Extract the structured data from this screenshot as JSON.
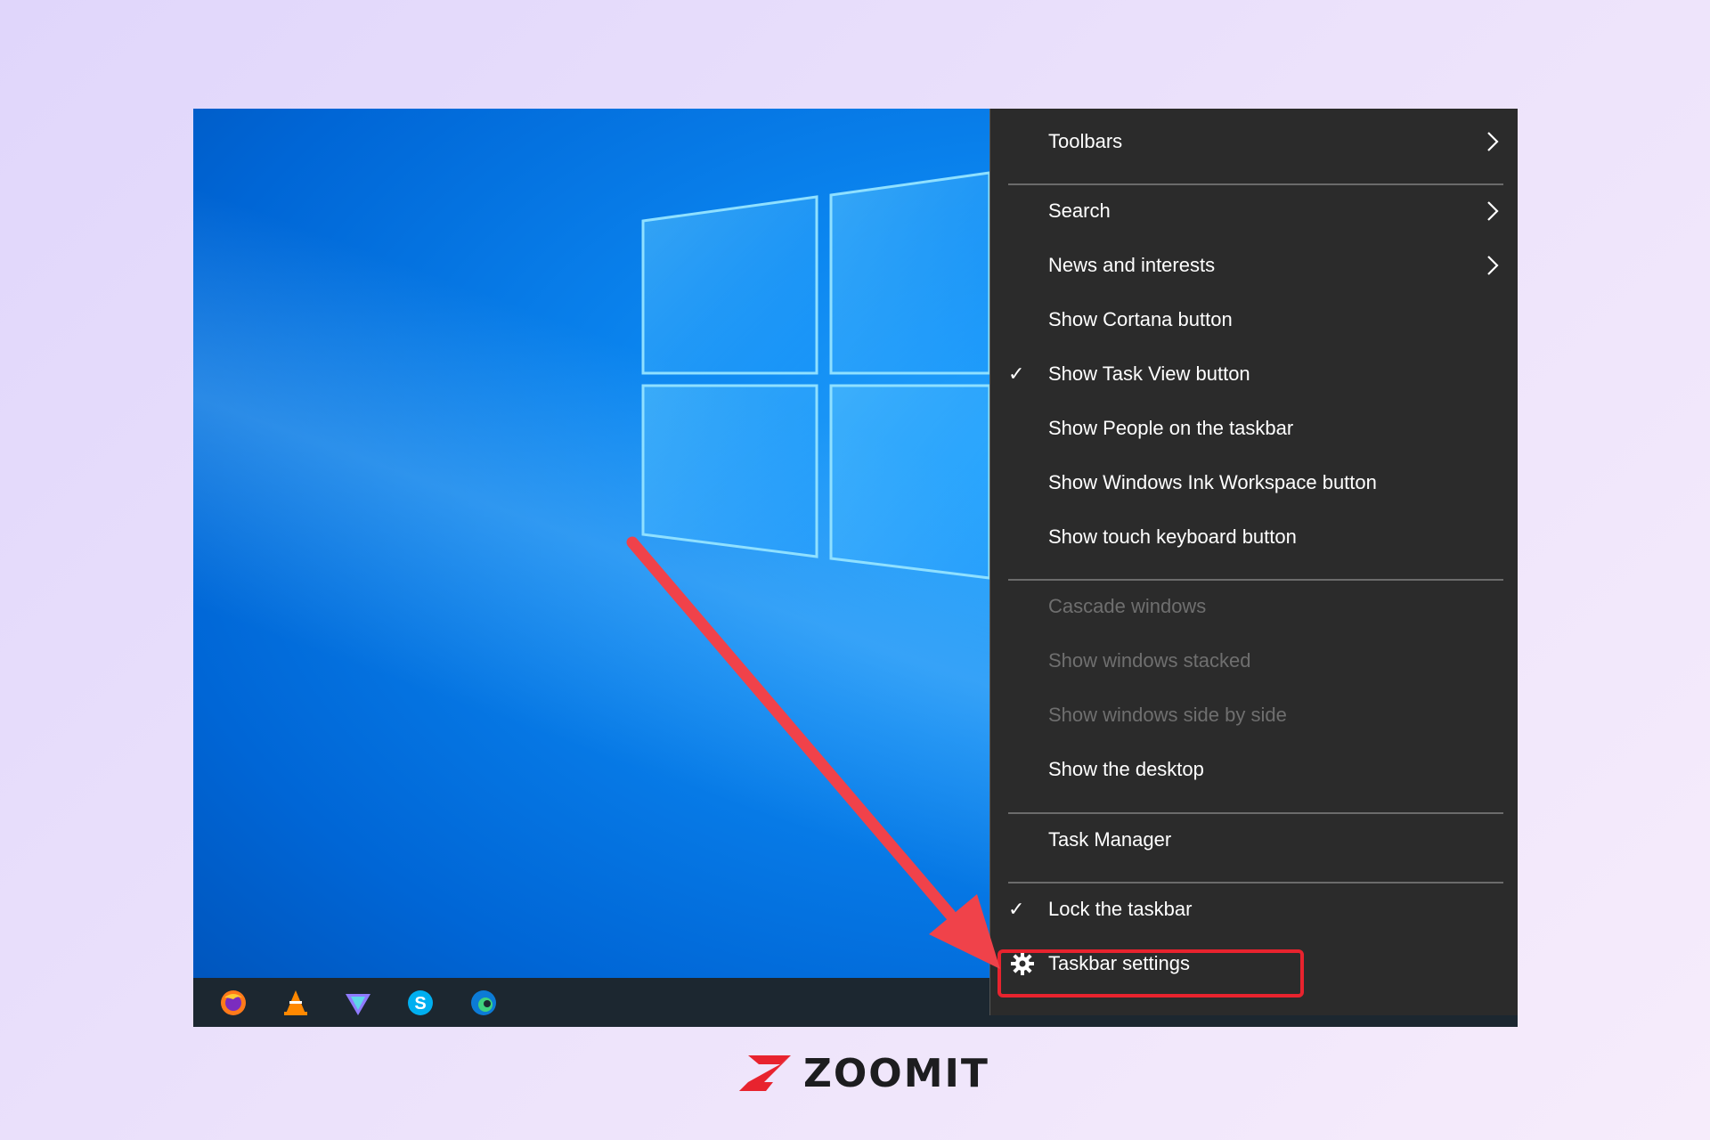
{
  "context_menu": {
    "items": [
      {
        "label": "Toolbars",
        "submenu": true,
        "checked": false,
        "disabled": false
      },
      {
        "label": "Search",
        "submenu": true,
        "checked": false,
        "disabled": false
      },
      {
        "label": "News and interests",
        "submenu": true,
        "checked": false,
        "disabled": false
      },
      {
        "label": "Show Cortana button",
        "submenu": false,
        "checked": false,
        "disabled": false
      },
      {
        "label": "Show Task View button",
        "submenu": false,
        "checked": true,
        "disabled": false
      },
      {
        "label": "Show People on the taskbar",
        "submenu": false,
        "checked": false,
        "disabled": false
      },
      {
        "label": "Show Windows Ink Workspace button",
        "submenu": false,
        "checked": false,
        "disabled": false
      },
      {
        "label": "Show touch keyboard button",
        "submenu": false,
        "checked": false,
        "disabled": false
      },
      {
        "label": "Cascade windows",
        "submenu": false,
        "checked": false,
        "disabled": true
      },
      {
        "label": "Show windows stacked",
        "submenu": false,
        "checked": false,
        "disabled": true
      },
      {
        "label": "Show windows side by side",
        "submenu": false,
        "checked": false,
        "disabled": true
      },
      {
        "label": "Show the desktop",
        "submenu": false,
        "checked": false,
        "disabled": false
      },
      {
        "label": "Task Manager",
        "submenu": false,
        "checked": false,
        "disabled": false
      },
      {
        "label": "Lock the taskbar",
        "submenu": false,
        "checked": true,
        "disabled": false
      },
      {
        "label": "Taskbar settings",
        "submenu": false,
        "checked": false,
        "disabled": false,
        "icon": "gear-icon",
        "highlighted": true
      }
    ],
    "check_glyph": "✓"
  },
  "taskbar": {
    "icons": [
      "firefox-icon",
      "vlc-icon",
      "proton-vpn-icon",
      "skype-icon",
      "edge-icon"
    ],
    "active_icon": "edge-icon"
  },
  "brand": {
    "name": "ZOOMIT",
    "mark_color": "#e8232e"
  },
  "colors": {
    "menu_background": "#2b2b2b",
    "highlight": "#e8232e",
    "annotation_arrow": "#f0424a",
    "desktop_blue": "#0b86f0"
  }
}
